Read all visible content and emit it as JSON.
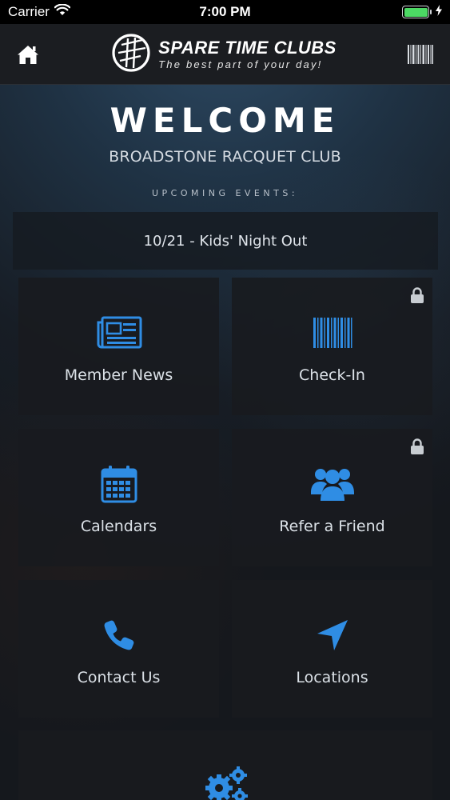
{
  "status_bar": {
    "carrier": "Carrier",
    "time": "7:00 PM",
    "battery_level": 1.0,
    "battery_color": "#4cd964"
  },
  "header": {
    "home_icon": "home-icon",
    "brand_name": "SPARE TIME CLUBS",
    "brand_tagline": "The best part of your day!",
    "barcode_icon": "barcode-icon"
  },
  "welcome": {
    "title": "WELCOME",
    "club_name": "BROADSTONE RACQUET CLUB",
    "events_label": "UPCOMING EVENTS:",
    "event": "10/21 - Kids' Night Out"
  },
  "tiles": [
    {
      "label": "Member News",
      "icon": "newspaper-icon",
      "locked": false
    },
    {
      "label": "Check-In",
      "icon": "barcode-icon",
      "locked": true
    },
    {
      "label": "Calendars",
      "icon": "calendar-icon",
      "locked": false
    },
    {
      "label": "Refer a Friend",
      "icon": "users-icon",
      "locked": true
    },
    {
      "label": "Contact Us",
      "icon": "phone-icon",
      "locked": false
    },
    {
      "label": "Locations",
      "icon": "location-arrow-icon",
      "locked": false
    },
    {
      "label": "",
      "icon": "gears-icon",
      "locked": false
    }
  ],
  "colors": {
    "accent": "#2f8de4",
    "lock": "#c8cdd2",
    "header_bg": "#1b1d21"
  }
}
